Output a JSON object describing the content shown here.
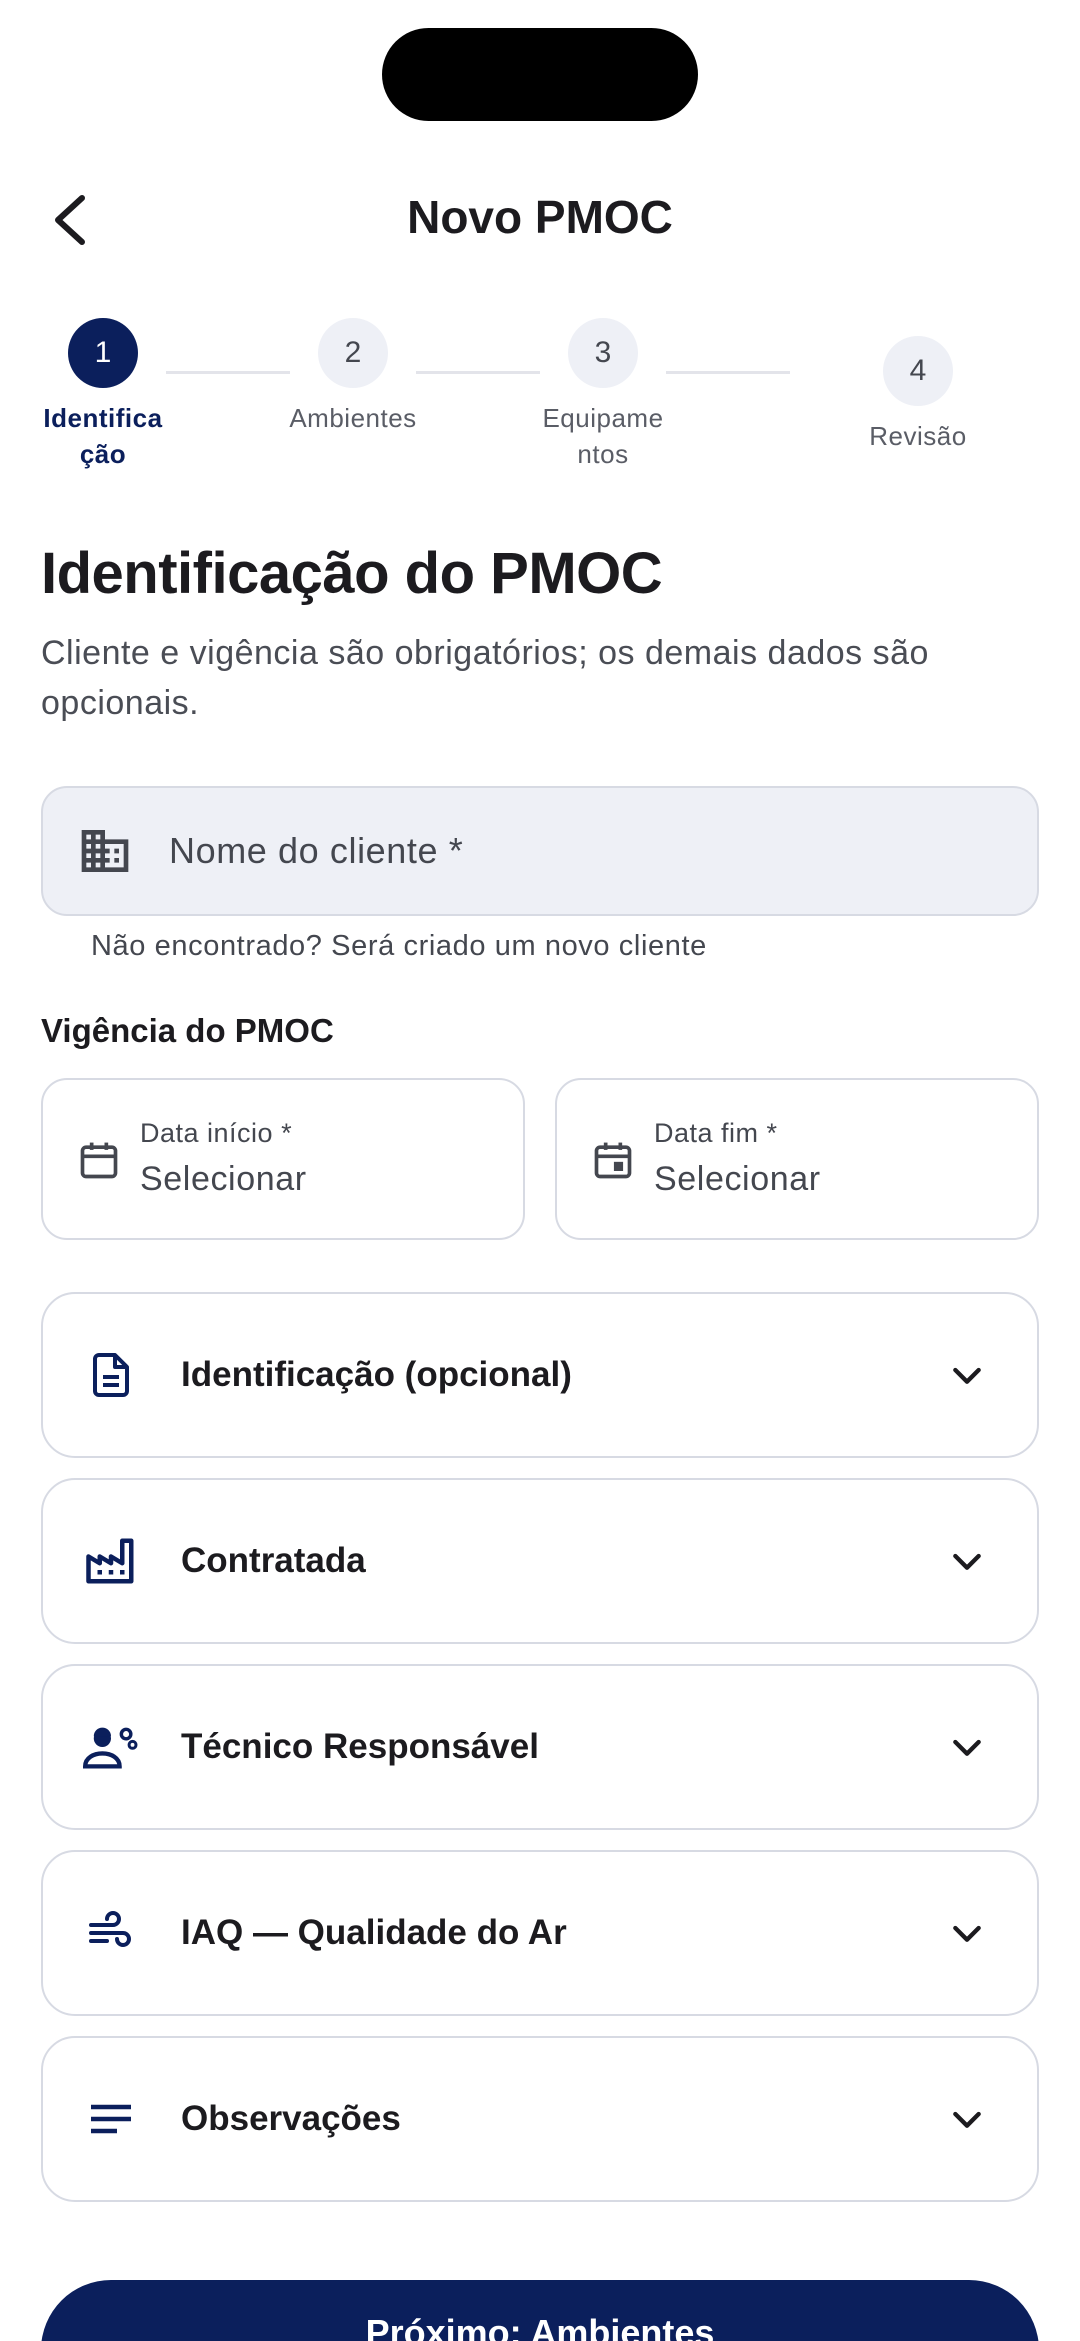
{
  "app_bar": {
    "title": "Novo PMOC"
  },
  "stepper": {
    "steps": [
      {
        "number": "1",
        "label": "Identificação"
      },
      {
        "number": "2",
        "label": "Ambientes"
      },
      {
        "number": "3",
        "label": "Equipamentos"
      },
      {
        "number": "4",
        "label": "Revisão"
      }
    ],
    "active_step": 1
  },
  "section": {
    "title": "Identificação do PMOC",
    "subtitle": "Cliente e vigência são obrigatórios; os demais dados são opcionais."
  },
  "client": {
    "placeholder": "Nome do cliente *",
    "helper": "Não encontrado? Será criado um novo cliente"
  },
  "vigencia": {
    "label": "Vigência do PMOC",
    "start": {
      "label": "Data início *",
      "value": "Selecionar"
    },
    "end": {
      "label": "Data fim *",
      "value": "Selecionar"
    }
  },
  "accordions": [
    {
      "label": "Identificação (opcional)",
      "icon": "document-icon"
    },
    {
      "label": "Contratada",
      "icon": "factory-icon"
    },
    {
      "label": "Técnico Responsável",
      "icon": "technician-icon"
    },
    {
      "label": "IAQ — Qualidade do Ar",
      "icon": "air-icon"
    },
    {
      "label": "Observações",
      "icon": "notes-icon"
    }
  ],
  "footer": {
    "next_label": "Próximo: Ambientes"
  },
  "colors": {
    "primary": "#0b1f5c",
    "surface_variant": "#eef0f6",
    "outline": "#d7dae3"
  }
}
